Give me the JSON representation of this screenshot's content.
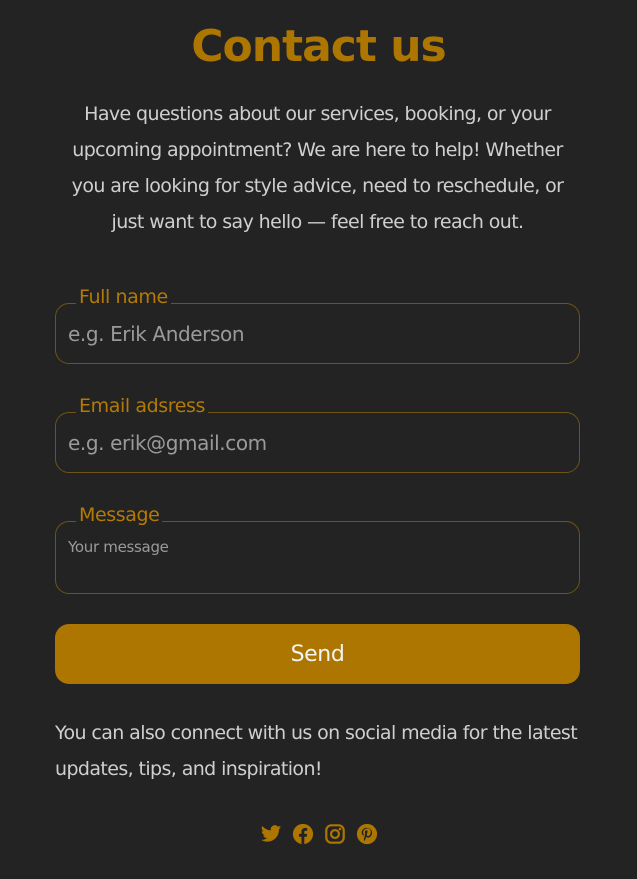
{
  "header": {
    "title": "Contact us",
    "intro": "Have questions about our services, booking, or your upcoming appointment? We are here to help! Whether you are looking for style advice, need to reschedule, or just want to say hello — feel free to reach out."
  },
  "form": {
    "name": {
      "label": "Full name",
      "placeholder": "e.g. Erik Anderson",
      "value": ""
    },
    "email": {
      "label": "Email adsress",
      "placeholder": "e.g. erik@gmail.com",
      "value": ""
    },
    "message": {
      "label": "Message",
      "placeholder": "Your message",
      "value": ""
    },
    "send_label": "Send"
  },
  "social": {
    "text": "You can also connect with us on social media for the latest updates, tips, and inspiration!",
    "icons": [
      "twitter-icon",
      "facebook-icon",
      "instagram-icon",
      "pinterest-icon"
    ]
  },
  "colors": {
    "background": "#232323",
    "accent": "#ad7600",
    "text": "#cfcfcf",
    "field_border": "#6e5417"
  }
}
